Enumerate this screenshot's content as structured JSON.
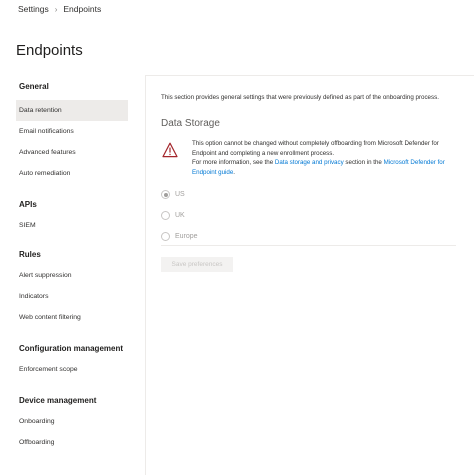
{
  "breadcrumb": {
    "root": "Settings",
    "current": "Endpoints"
  },
  "page_title": "Endpoints",
  "sidebar": {
    "groups": [
      {
        "title": "General",
        "items": [
          "Data retention",
          "Email notifications",
          "Advanced features",
          "Auto remediation"
        ]
      },
      {
        "title": "APIs",
        "items": [
          "SIEM"
        ]
      },
      {
        "title": "Rules",
        "items": [
          "Alert suppression",
          "Indicators",
          "Web content filtering"
        ]
      },
      {
        "title": "Configuration management",
        "items": [
          "Enforcement scope"
        ]
      },
      {
        "title": "Device management",
        "items": [
          "Onboarding",
          "Offboarding"
        ]
      }
    ]
  },
  "main": {
    "intro": "This section provides general settings that were previously defined as part of the onboarding process.",
    "section_title": "Data Storage",
    "warning": {
      "icon": "warning-icon",
      "line1": "This option cannot be changed without completely offboarding from Microsoft Defender for Endpoint and completing a new enrollment process.",
      "line2_prefix": "For more information, see the ",
      "link1": "Data storage and privacy",
      "line2_mid": " section in the ",
      "link2": "Microsoft Defender for Endpoint guide",
      "line2_suffix": "."
    },
    "radios": {
      "options": [
        "US",
        "UK",
        "Europe"
      ],
      "selected": "US"
    },
    "save_label": "Save preferences"
  },
  "colors": {
    "link": "#0078d4",
    "active_bg": "#edebe9",
    "warning": "#a4262c"
  }
}
